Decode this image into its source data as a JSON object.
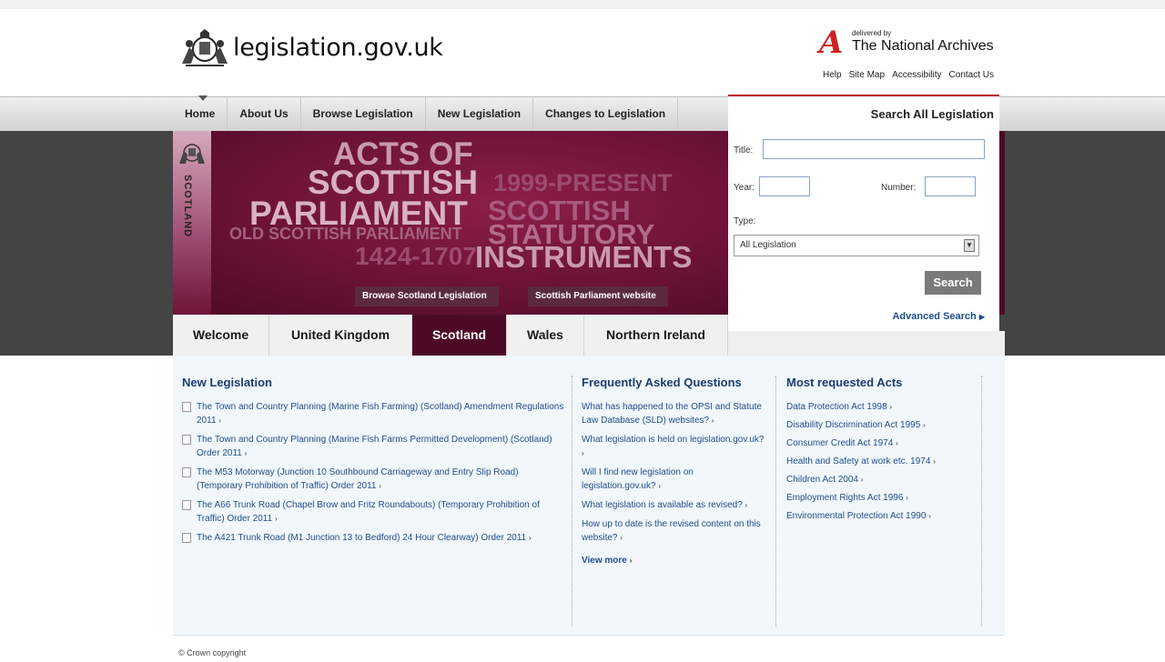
{
  "header": {
    "site_name": "legislation.gov.uk",
    "tna_letter": "A",
    "tna_delivered": "delivered by",
    "tna_name": "The National Archives",
    "util_links": [
      "Help",
      "Site Map",
      "Accessibility",
      "Contact Us"
    ]
  },
  "nav": {
    "items": [
      "Home",
      "About Us",
      "Browse Legislation",
      "New Legislation",
      "Changes to Legislation"
    ]
  },
  "hero": {
    "side_label": "SCOTLAND",
    "words": {
      "acts_of": "ACTS OF",
      "scottish": "SCOTTISH",
      "present": "1999-PRESENT",
      "parliament": "PARLIAMENT",
      "scottish2": "SCOTTISH",
      "old": "OLD SCOTTISH PARLIAMENT",
      "statutory": "STATUTORY",
      "years": "1424-1707",
      "instruments": "INSTRUMENTS"
    },
    "browse_button": "Browse Scotland Legislation",
    "parliament_button": "Scottish Parliament website"
  },
  "jurisdiction_tabs": [
    "Welcome",
    "United Kingdom",
    "Scotland",
    "Wales",
    "Northern Ireland"
  ],
  "search": {
    "title": "Search All Legislation",
    "title_label": "Title:",
    "year_label": "Year:",
    "number_label": "Number:",
    "type_label": "Type:",
    "type_selected": "All Legislation",
    "button": "Search",
    "advanced": "Advanced Search"
  },
  "new_legislation": {
    "heading": "New Legislation",
    "items": [
      "The Town and Country Planning (Marine Fish Farming) (Scotland) Amendment Regulations 2011",
      "The Town and Country Planning (Marine Fish Farms Permitted Development) (Scotland) Order 2011",
      "The M53 Motorway (Junction 10 Southbound Carriageway and Entry Slip Road) (Temporary Prohibition of Traffic) Order 2011",
      "The A66 Trunk Road (Chapel Brow and Fritz Roundabouts) (Temporary Prohibition of Traffic) Order 2011",
      "The A421 Trunk Road (M1 Junction 13 to Bedford) 24 Hour Clearway) Order 2011"
    ]
  },
  "faq": {
    "heading": "Frequently Asked Questions",
    "items": [
      "What has happened to the OPSI and Statute Law Database (SLD) websites?",
      "What legislation is held on legislation.gov.uk?",
      "Will I find new legislation on legislation.gov.uk?",
      "What legislation is available as revised?",
      "How up to date is the revised content on this website?"
    ],
    "view_more": "View more"
  },
  "most_requested": {
    "heading": "Most requested Acts",
    "items": [
      "Data Protection Act 1998",
      "Disability Discrimination Act 1995",
      "Consumer Credit Act 1974",
      "Health and Safety at work etc. 1974",
      "Children Act 2004",
      "Employment Rights Act 1996",
      "Environmental Protection Act 1990"
    ]
  },
  "footer": {
    "copyright": "© Crown copyright"
  }
}
